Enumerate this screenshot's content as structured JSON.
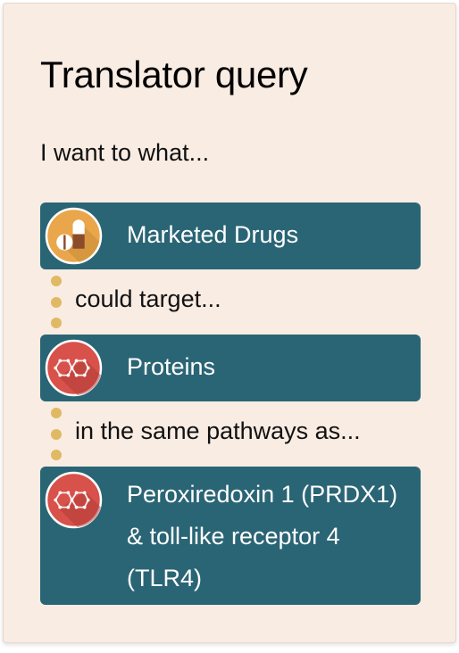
{
  "card": {
    "title": "Translator query",
    "intro": "I want to what..."
  },
  "steps": [
    {
      "label": "Marketed Drugs",
      "icon": "pills-icon",
      "icon_color": "#e9a64a"
    },
    {
      "label": "Proteins",
      "icon": "molecule-icon",
      "icon_color": "#d8514a"
    },
    {
      "label": "Peroxiredoxin 1 (PRDX1) & toll-like receptor 4 (TLR4)",
      "icon": "molecule-icon",
      "icon_color": "#d8514a"
    }
  ],
  "connectors": [
    {
      "text": "could target..."
    },
    {
      "text": "in the same pathways as..."
    }
  ],
  "colors": {
    "card_background": "#f9ece3",
    "step_background": "#2a6575",
    "connector_dot": "#e0b964"
  }
}
